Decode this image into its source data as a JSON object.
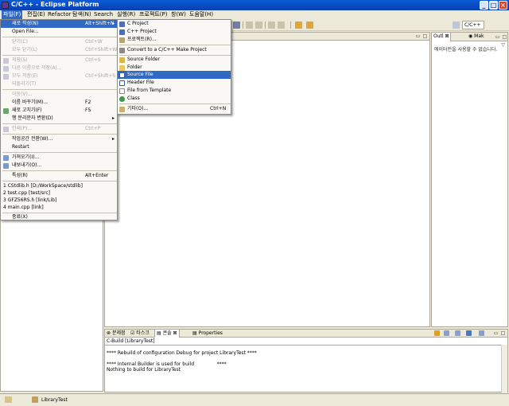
{
  "window": {
    "title": "C/C++ - Eclipse Platform"
  },
  "menubar": [
    {
      "label": "파일(F)"
    },
    {
      "label": "편집(E)"
    },
    {
      "label": "Refactor"
    },
    {
      "label": "탐색(N)"
    },
    {
      "label": "Search"
    },
    {
      "label": "실행(R)"
    },
    {
      "label": "프로젝트(P)"
    },
    {
      "label": "창(W)"
    },
    {
      "label": "도움말(H)"
    }
  ],
  "perspective": {
    "label": "C/C++"
  },
  "file_menu": {
    "items": [
      {
        "label": "새로 작성(N)",
        "accel": "Alt+Shift+N",
        "submenu": true,
        "state": "active"
      },
      {
        "label": "Open File...",
        "accel": "",
        "state": "normal"
      },
      {
        "label": "닫기(C)",
        "accel": "Ctrl+W",
        "state": "disabled"
      },
      {
        "label": "모두 닫기(L)",
        "accel": "Ctrl+Shift+W",
        "state": "disabled"
      },
      {
        "label": "저장(S)",
        "accel": "Ctrl+S",
        "state": "disabled"
      },
      {
        "label": "다른 이름으로 저장(A)...",
        "accel": "",
        "state": "disabled"
      },
      {
        "label": "모두 저장(E)",
        "accel": "Ctrl+Shift+S",
        "state": "disabled"
      },
      {
        "label": "되돌리기(T)",
        "accel": "",
        "state": "disabled"
      },
      {
        "label": "이동(V)...",
        "accel": "",
        "state": "disabled"
      },
      {
        "label": "이름 바꾸기(M)...",
        "accel": "F2",
        "state": "normal"
      },
      {
        "label": "새로 고치기(F)",
        "accel": "F5",
        "state": "normal"
      },
      {
        "label": "행 분리문자 변환(D)",
        "accel": "",
        "submenu": true,
        "state": "normal"
      },
      {
        "label": "인쇄(P)...",
        "accel": "Ctrl+P",
        "state": "disabled"
      },
      {
        "label": "작업공간 전환(W)...",
        "accel": "",
        "submenu": true,
        "state": "normal"
      },
      {
        "label": "Restart",
        "accel": "",
        "state": "normal"
      },
      {
        "label": "가져오기(I)...",
        "accel": "",
        "state": "normal"
      },
      {
        "label": "내보내기(O)...",
        "accel": "",
        "state": "normal"
      },
      {
        "label": "특성(R)",
        "accel": "Alt+Enter",
        "state": "normal"
      },
      {
        "label": "1 CStdlib.h  [D:/WorkSpace/stdlib]",
        "accel": "",
        "state": "normal"
      },
      {
        "label": "2 test.cpp  [test/src]",
        "accel": "",
        "state": "normal"
      },
      {
        "label": "3 GFZ56RS.h  [link/Lib]",
        "accel": "",
        "state": "normal"
      },
      {
        "label": "4 main.cpp  [link]",
        "accel": "",
        "state": "normal"
      },
      {
        "label": "종료(X)",
        "accel": "",
        "state": "normal"
      }
    ]
  },
  "new_submenu": {
    "items": [
      {
        "label": "C Project",
        "accel": ""
      },
      {
        "label": "C++ Project",
        "accel": ""
      },
      {
        "label": "프로젝트(R)...",
        "accel": ""
      },
      {
        "label": "Convert to a C/C++ Make Project",
        "accel": ""
      },
      {
        "label": "Source Folder",
        "accel": ""
      },
      {
        "label": "Folder",
        "accel": ""
      },
      {
        "label": "Source File",
        "accel": "",
        "state": "active"
      },
      {
        "label": "Header File",
        "accel": ""
      },
      {
        "label": "File from Template",
        "accel": ""
      },
      {
        "label": "Class",
        "accel": ""
      },
      {
        "label": "기타(O)...",
        "accel": "Ctrl+N"
      }
    ]
  },
  "outline": {
    "tabs": [
      {
        "label": "Outl"
      },
      {
        "label": "Mak"
      }
    ],
    "message": "에이터런을 사용할 수 없습니다."
  },
  "console": {
    "tabs": [
      {
        "label": "문제점"
      },
      {
        "label": "타스크"
      },
      {
        "label": "콘솔"
      },
      {
        "label": "Properties"
      }
    ],
    "title": "C-Build [LibraryTest]",
    "lines": [
      "**** Rebuild of configuration Debug for project LibraryTest ****",
      "",
      "**** Internal Builder is used for build               ****",
      "Nothing to build for LibraryTest"
    ]
  },
  "statusbar": {
    "project": "LibraryTest"
  },
  "colors": {
    "titlebar": "#0a4fc8",
    "menu_highlight": "#316ac5",
    "chrome": "#ece9d8"
  }
}
